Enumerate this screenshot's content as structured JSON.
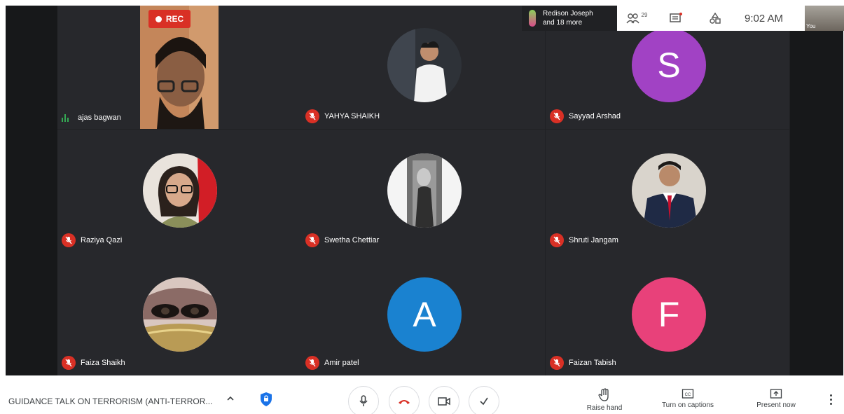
{
  "recording": {
    "label": "REC"
  },
  "overlay": {
    "participants_text_1": "Redison Joseph",
    "participants_text_2": "and 18 more",
    "people_count": "29",
    "time": "9:02 AM",
    "you_label": "You"
  },
  "tiles": [
    {
      "name": "ajas bagwan",
      "type": "video",
      "muted": false
    },
    {
      "name": "YAHYA SHAIKH",
      "type": "photo",
      "muted": true
    },
    {
      "name": "Sayyad Arshad",
      "type": "letter",
      "letter": "S",
      "color": "#a142c4",
      "muted": true
    },
    {
      "name": "Raziya Qazi",
      "type": "photo",
      "muted": true
    },
    {
      "name": "Swetha Chettiar",
      "type": "photo",
      "muted": true
    },
    {
      "name": "Shruti Jangam",
      "type": "photo",
      "muted": true
    },
    {
      "name": "Faiza Shaikh",
      "type": "photo",
      "muted": true
    },
    {
      "name": "Amir patel",
      "type": "letter",
      "letter": "A",
      "color": "#1a82d0",
      "muted": true
    },
    {
      "name": "Faizan Tabish",
      "type": "letter",
      "letter": "F",
      "color": "#e8417a",
      "muted": true
    }
  ],
  "bottom_bar": {
    "meeting_title": "GUIDANCE TALK ON TERRORISM (ANTI-TERROR...",
    "raise_hand": "Raise hand",
    "captions": "Turn on captions",
    "present": "Present now"
  },
  "colors": {
    "stage": "#202124",
    "tile": "#27282c",
    "mute": "#d93025",
    "accent_red": "#d93025"
  }
}
